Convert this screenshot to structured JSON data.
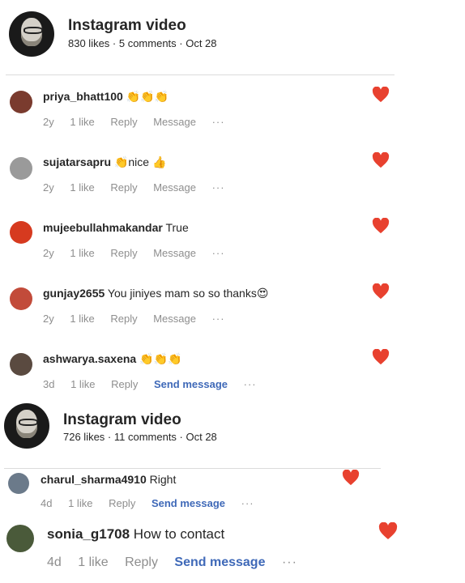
{
  "posts": [
    {
      "title": "Instagram video",
      "meta": "830 likes · 5 comments · Oct 28",
      "comments": [
        {
          "user": "priya_bhatt100",
          "text": "",
          "emoji": "👏👏👏",
          "age": "2y",
          "likes": "1 like",
          "reply": "Reply",
          "message": "Message",
          "more": "···",
          "avatar_color": "#7a3b2e"
        },
        {
          "user": "sujatarsapru",
          "text": "nice",
          "emoji_before": "👏",
          "emoji": "👍",
          "age": "2y",
          "likes": "1 like",
          "reply": "Reply",
          "message": "Message",
          "more": "···",
          "avatar_color": "#9a9a9a"
        },
        {
          "user": "mujeebullahmakandar",
          "text": "True",
          "emoji": "",
          "age": "2y",
          "likes": "1 like",
          "reply": "Reply",
          "message": "Message",
          "more": "···",
          "avatar_color": "#d63a1f"
        },
        {
          "user": "gunjay2655",
          "text": "You jiniyes mam so so thanks",
          "emoji": "😍",
          "age": "2y",
          "likes": "1 like",
          "reply": "Reply",
          "message": "Message",
          "more": "···",
          "avatar_color": "#c24b3a"
        },
        {
          "user": "ashwarya.saxena",
          "text": "",
          "emoji": "👏👏👏",
          "age": "3d",
          "likes": "1 like",
          "reply": "Reply",
          "message": "Send message",
          "more": "···",
          "avatar_color": "#5a4a40"
        }
      ]
    },
    {
      "title": "Instagram video",
      "meta": "726 likes · 11 comments · Oct 28",
      "comments": [
        {
          "user": "charul_sharma4910",
          "text": "Right",
          "emoji": "",
          "age": "4d",
          "likes": "1 like",
          "reply": "Reply",
          "message": "Send message",
          "more": "···",
          "avatar_color": "#6b7a8a"
        },
        {
          "user": "sonia_g1708",
          "text": "How to contact",
          "emoji": "",
          "age": "4d",
          "likes": "1 like",
          "reply": "Reply",
          "message": "Send message",
          "more": "···",
          "avatar_color": "#4a5a3a"
        }
      ]
    }
  ],
  "colors": {
    "heart": "#e8412f",
    "send_message": "#3f69b8",
    "meta_gray": "#8e8e8e"
  }
}
